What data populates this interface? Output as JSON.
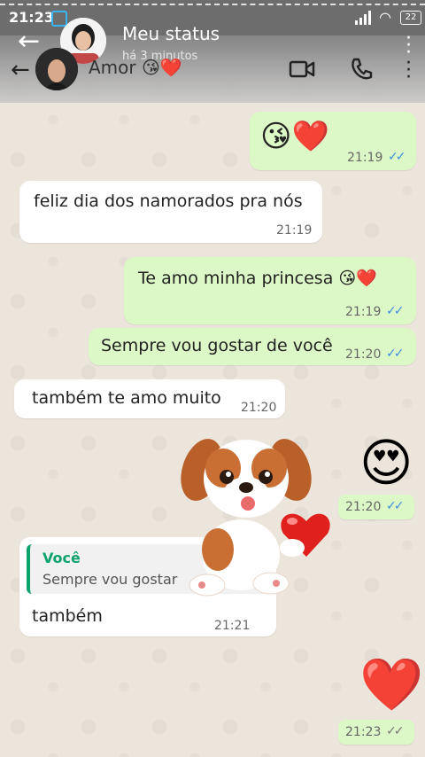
{
  "status_bar": {
    "time": "21:23",
    "battery": "22"
  },
  "story": {
    "title": "Meu status",
    "subtitle": "há 3 minutos"
  },
  "chat": {
    "contact_name": "Amor",
    "contact_emojis": "😘❤️"
  },
  "messages": [
    {
      "id": "m1",
      "dir": "out",
      "text": "😘❤️",
      "time": "21:19",
      "ticks": "✓✓",
      "read": true
    },
    {
      "id": "m2",
      "dir": "in",
      "text": "feliz dia dos namorados pra nós",
      "time": "21:19"
    },
    {
      "id": "m3",
      "dir": "out",
      "text": "Te amo minha princesa 😘❤️",
      "time": "21:19",
      "ticks": "✓✓",
      "read": true
    },
    {
      "id": "m4",
      "dir": "out",
      "text": "Sempre vou gostar de você",
      "time": "21:20",
      "ticks": "✓✓",
      "read": true
    },
    {
      "id": "m5",
      "dir": "in",
      "text": "também te amo muito",
      "time": "21:20"
    },
    {
      "id": "m6",
      "dir": "out",
      "text": "😍",
      "time": "21:20",
      "ticks": "✓✓",
      "read": true
    },
    {
      "id": "m7",
      "dir": "in",
      "quote_author": "Você",
      "quote_text": "Sempre vou gostar",
      "text": "também",
      "time": "21:21"
    },
    {
      "id": "m8",
      "dir": "out",
      "text": "❤️",
      "time": "21:23",
      "ticks": "✓✓",
      "read": false
    }
  ],
  "colors": {
    "outgoing": "#dcf8c6",
    "incoming": "#ffffff",
    "read_ticks": "#3f8fdc",
    "quote_accent": "#0aa36c"
  },
  "icons": [
    "arrow-left-icon",
    "video-call-icon",
    "phone-icon",
    "more-vert-icon",
    "puppy-sticker"
  ]
}
